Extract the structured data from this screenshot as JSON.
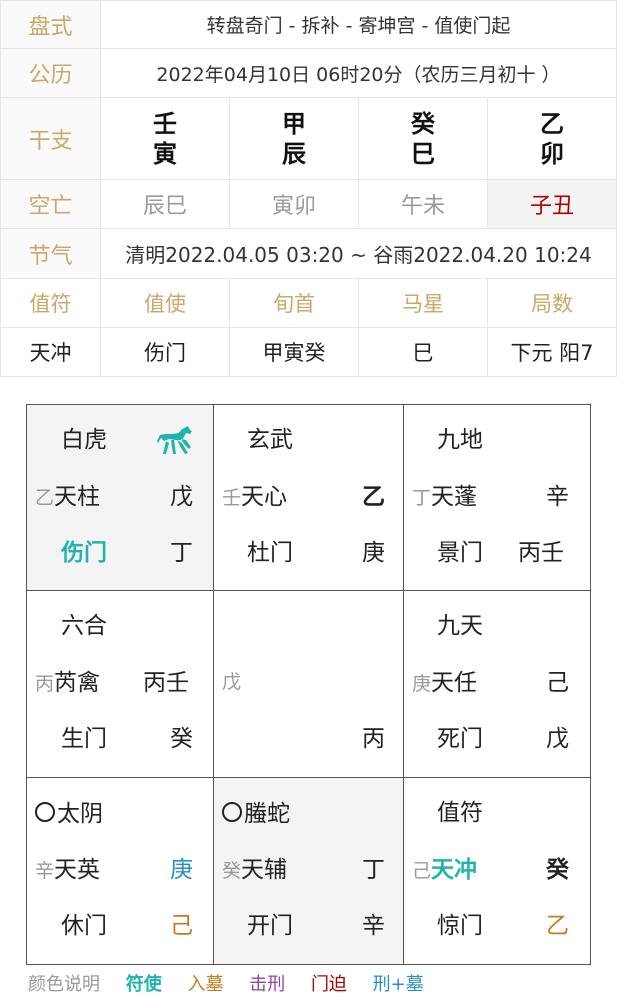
{
  "info": {
    "pan_label": "盘式",
    "pan_value": "转盘奇门 - 拆补 - 寄坤宫 - 值使门起",
    "gongli_label": "公历",
    "gongli_value": "2022年04月10日 06时20分（农历三月初十 ）",
    "ganzhi_label": "干支",
    "ganzhi": [
      {
        "top": "壬",
        "bottom": "寅"
      },
      {
        "top": "甲",
        "bottom": "辰"
      },
      {
        "top": "癸",
        "bottom": "巳"
      },
      {
        "top": "乙",
        "bottom": "卯"
      }
    ],
    "kongwang_label": "空亡",
    "kongwang": [
      "辰巳",
      "寅卯",
      "午未",
      "子丑"
    ],
    "jieqi_label": "节气",
    "jieqi_value": "清明2022.04.05 03:20 ~ 谷雨2022.04.20 10:24",
    "headers": [
      "值符",
      "值使",
      "旬首",
      "马星",
      "局数"
    ],
    "values": [
      "天冲",
      "伤门",
      "甲寅癸",
      "巳",
      "下元 阳7"
    ]
  },
  "palaces": [
    {
      "god": "白虎",
      "small": "乙",
      "star": "天柱",
      "star_right": "戊",
      "door": "伤门",
      "door_right": "丁",
      "has_horse": true
    },
    {
      "god": "玄武",
      "small": "壬",
      "star": "天心",
      "star_right": "乙",
      "door": "杜门",
      "door_right": "庚"
    },
    {
      "god": "九地",
      "small": "丁",
      "star": "天蓬",
      "star_right": "辛",
      "door": "景门",
      "door_right": "丙壬"
    },
    {
      "god": "六合",
      "small": "丙",
      "star": "芮禽",
      "star_right": "丙壬",
      "door": "生门",
      "door_right": "癸"
    },
    {
      "center_small": "戊",
      "center_right": "丙"
    },
    {
      "god": "九天",
      "small": "庚",
      "star": "天任",
      "star_right": "己",
      "door": "死门",
      "door_right": "戊"
    },
    {
      "god": "太阴",
      "small": "辛",
      "star": "天英",
      "star_right": "庚",
      "door": "休门",
      "door_right": "己"
    },
    {
      "god": "螣蛇",
      "small": "癸",
      "star": "天辅",
      "star_right": "丁",
      "door": "开门",
      "door_right": "辛"
    },
    {
      "god": "值符",
      "small": "己",
      "star": "天冲",
      "star_right": "癸",
      "door": "惊门",
      "door_right": "乙"
    }
  ],
  "legend": [
    "颜色说明",
    "符使",
    "入墓",
    "击刑",
    "门迫",
    "刑+墓"
  ],
  "colors": {
    "accent_gold": "#c9a86a",
    "teal": "#1fb5ad",
    "blue": "#2a8fc0",
    "orange": "#c8781f",
    "red": "#b00000"
  }
}
